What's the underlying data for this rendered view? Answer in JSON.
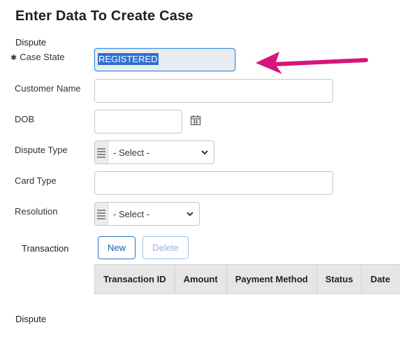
{
  "title": "Enter Data To Create Case",
  "sections": {
    "top": "Dispute",
    "bottom": "Dispute"
  },
  "fields": {
    "case_state": {
      "label": "Case State",
      "required_mark": "✱",
      "value": "REGISTERED"
    },
    "customer_name": {
      "label": "Customer Name",
      "value": ""
    },
    "dob": {
      "label": "DOB",
      "value": ""
    },
    "dispute_type": {
      "label": "Dispute Type",
      "selected": "- Select -"
    },
    "card_type": {
      "label": "Card Type",
      "value": ""
    },
    "resolution": {
      "label": "Resolution",
      "selected": "- Select -"
    }
  },
  "transaction": {
    "label": "Transaction",
    "new_button": "New",
    "delete_button": "Delete",
    "columns": [
      "Transaction ID",
      "Amount",
      "Payment Method",
      "Status",
      "Date"
    ]
  },
  "icons": {
    "calendar": "calendar-icon",
    "list": "list-icon",
    "chevron": "chevron-down-icon",
    "annotation_arrow": "arrow-left-icon"
  },
  "colors": {
    "accent": "#2a73c6",
    "selection": "#2f6fd1",
    "annotation_arrow": "#d6157e"
  }
}
